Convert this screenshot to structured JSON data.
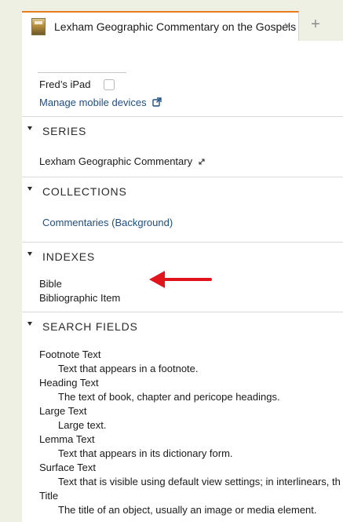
{
  "tab": {
    "title": "Lexham Geographic Commentary on the Gospels",
    "close_glyph": "×",
    "add_glyph": "+"
  },
  "devices": {
    "device_name": "Fred’s iPad",
    "device_checked": false,
    "manage_link": "Manage mobile devices"
  },
  "series": {
    "heading": "SERIES",
    "value": "Lexham Geographic Commentary"
  },
  "collections": {
    "heading": "COLLECTIONS",
    "item": "Commentaries (Background)"
  },
  "indexes": {
    "heading": "INDEXES",
    "items": [
      "Bible",
      "Bibliographic Item"
    ]
  },
  "search_fields": {
    "heading": "SEARCH FIELDS",
    "fields": [
      {
        "name": "Footnote Text",
        "description": "Text that appears in a footnote."
      },
      {
        "name": "Heading Text",
        "description": "The text of book, chapter and pericope headings."
      },
      {
        "name": "Large Text",
        "description": "Large text."
      },
      {
        "name": "Lemma Text",
        "description": "Text that appears in its dictionary form."
      },
      {
        "name": "Surface Text",
        "description": "Text that is visible using default view settings; in interlinears, th"
      },
      {
        "name": "Title",
        "description": "The title of an object, usually an image or media element."
      }
    ]
  },
  "colors": {
    "accent_tab": "#e87d1e",
    "link": "#1f4e80",
    "arrow": "#e0141a"
  }
}
